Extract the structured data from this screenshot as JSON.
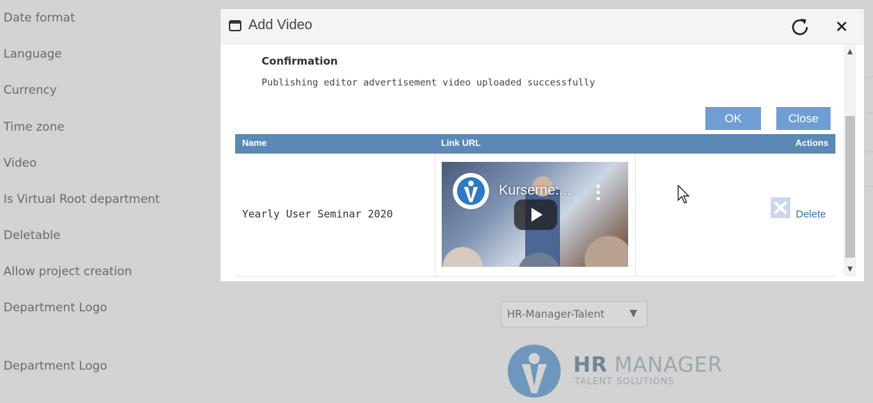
{
  "settings": {
    "labels": [
      "Date format",
      "Language",
      "Currency",
      "Time zone",
      "Video",
      "Is Virtual Root department",
      "Deletable",
      "Allow project creation",
      "Department Logo",
      "Department Logo"
    ],
    "logo_select": {
      "value": "HR-Manager-Talent"
    },
    "logo_brand": {
      "strong": "HR",
      "rest": " MANAGER",
      "tagline": "TALENT SOLUTIONS"
    }
  },
  "modal": {
    "title": "Add Video",
    "ok_label": "OK",
    "close_label": "Close",
    "table": {
      "headers": {
        "name": "Name",
        "link": "Link URL",
        "actions": "Actions"
      },
      "rows": [
        {
          "name": "Yearly User Seminar 2020",
          "video_title": "Kurserne:...",
          "action": "Delete"
        }
      ]
    },
    "toast": {
      "title": "Confirmation",
      "message": "Publishing editor advertisement video uploaded successfully"
    }
  },
  "colors": {
    "header_bar": "#5b88b4",
    "button": "#6e9ed4",
    "link": "#3a6fb0",
    "backdrop": "#d3d3d3"
  }
}
